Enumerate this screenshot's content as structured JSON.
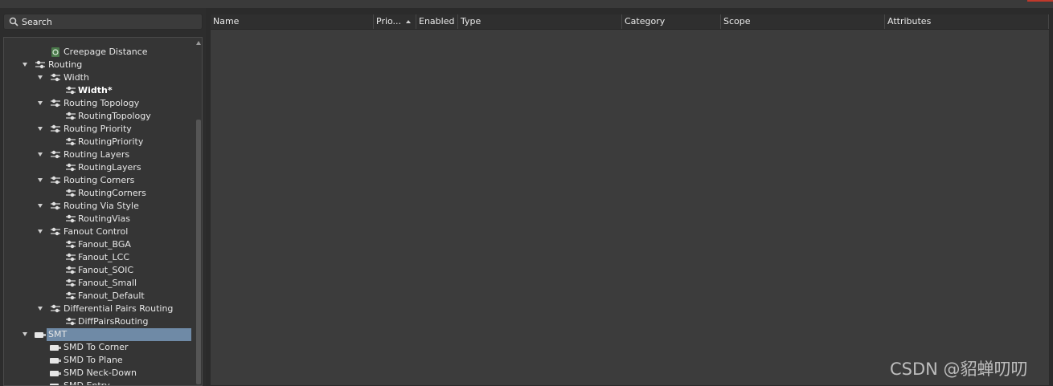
{
  "search": {
    "placeholder": "Search"
  },
  "tree": {
    "items": [
      {
        "label": "Creepage Distance",
        "icon": "rule-leaf-green-icon",
        "expanded": false,
        "selected": false,
        "bold": false
      },
      {
        "label": "Routing",
        "icon": "rule-category-icon",
        "expanded": true,
        "selected": false,
        "bold": false
      },
      {
        "label": "Width",
        "icon": "rule-category-icon",
        "expanded": true,
        "selected": false,
        "bold": false
      },
      {
        "label": "Width*",
        "icon": "rule-leaf-icon",
        "expanded": false,
        "selected": false,
        "bold": true
      },
      {
        "label": "Routing Topology",
        "icon": "rule-category-icon",
        "expanded": true,
        "selected": false,
        "bold": false
      },
      {
        "label": "RoutingTopology",
        "icon": "rule-leaf-icon",
        "expanded": false,
        "selected": false,
        "bold": false
      },
      {
        "label": "Routing Priority",
        "icon": "rule-category-icon",
        "expanded": true,
        "selected": false,
        "bold": false
      },
      {
        "label": "RoutingPriority",
        "icon": "rule-leaf-icon",
        "expanded": false,
        "selected": false,
        "bold": false
      },
      {
        "label": "Routing Layers",
        "icon": "rule-category-icon",
        "expanded": true,
        "selected": false,
        "bold": false
      },
      {
        "label": "RoutingLayers",
        "icon": "rule-leaf-icon",
        "expanded": false,
        "selected": false,
        "bold": false
      },
      {
        "label": "Routing Corners",
        "icon": "rule-category-icon",
        "expanded": true,
        "selected": false,
        "bold": false
      },
      {
        "label": "RoutingCorners",
        "icon": "rule-leaf-icon",
        "expanded": false,
        "selected": false,
        "bold": false
      },
      {
        "label": "Routing Via Style",
        "icon": "rule-category-icon",
        "expanded": true,
        "selected": false,
        "bold": false
      },
      {
        "label": "RoutingVias",
        "icon": "rule-leaf-icon",
        "expanded": false,
        "selected": false,
        "bold": false
      },
      {
        "label": "Fanout Control",
        "icon": "rule-category-icon",
        "expanded": true,
        "selected": false,
        "bold": false
      },
      {
        "label": "Fanout_BGA",
        "icon": "rule-leaf-icon",
        "expanded": false,
        "selected": false,
        "bold": false
      },
      {
        "label": "Fanout_LCC",
        "icon": "rule-leaf-icon",
        "expanded": false,
        "selected": false,
        "bold": false
      },
      {
        "label": "Fanout_SOIC",
        "icon": "rule-leaf-icon",
        "expanded": false,
        "selected": false,
        "bold": false
      },
      {
        "label": "Fanout_Small",
        "icon": "rule-leaf-icon",
        "expanded": false,
        "selected": false,
        "bold": false
      },
      {
        "label": "Fanout_Default",
        "icon": "rule-leaf-icon",
        "expanded": false,
        "selected": false,
        "bold": false
      },
      {
        "label": "Differential Pairs Routing",
        "icon": "rule-category-icon",
        "expanded": true,
        "selected": false,
        "bold": false
      },
      {
        "label": "DiffPairsRouting",
        "icon": "rule-leaf-icon",
        "expanded": false,
        "selected": false,
        "bold": false
      },
      {
        "label": "SMT",
        "icon": "smd-pad-icon",
        "expanded": true,
        "selected": true,
        "bold": false
      },
      {
        "label": "SMD To Corner",
        "icon": "smd-pad-icon",
        "expanded": false,
        "selected": false,
        "bold": false
      },
      {
        "label": "SMD To Plane",
        "icon": "smd-pad-icon",
        "expanded": false,
        "selected": false,
        "bold": false
      },
      {
        "label": "SMD Neck-Down",
        "icon": "smd-pad-icon",
        "expanded": false,
        "selected": false,
        "bold": false
      },
      {
        "label": "SMD Entry",
        "icon": "smd-pad-icon",
        "expanded": false,
        "selected": false,
        "bold": false
      }
    ]
  },
  "grid": {
    "columns": [
      {
        "label": "Name"
      },
      {
        "label": "Prio...",
        "sort": "ascending"
      },
      {
        "label": "Enabled"
      },
      {
        "label": "Type"
      },
      {
        "label": "Category"
      },
      {
        "label": "Scope"
      },
      {
        "label": "Attributes"
      }
    ],
    "rows": []
  },
  "watermark": "CSDN @貂蝉叨叨",
  "colors": {
    "selection": "#6f8aa6",
    "panel": "#353535",
    "grid": "#3c3c3c",
    "header": "#2f2f2f"
  }
}
